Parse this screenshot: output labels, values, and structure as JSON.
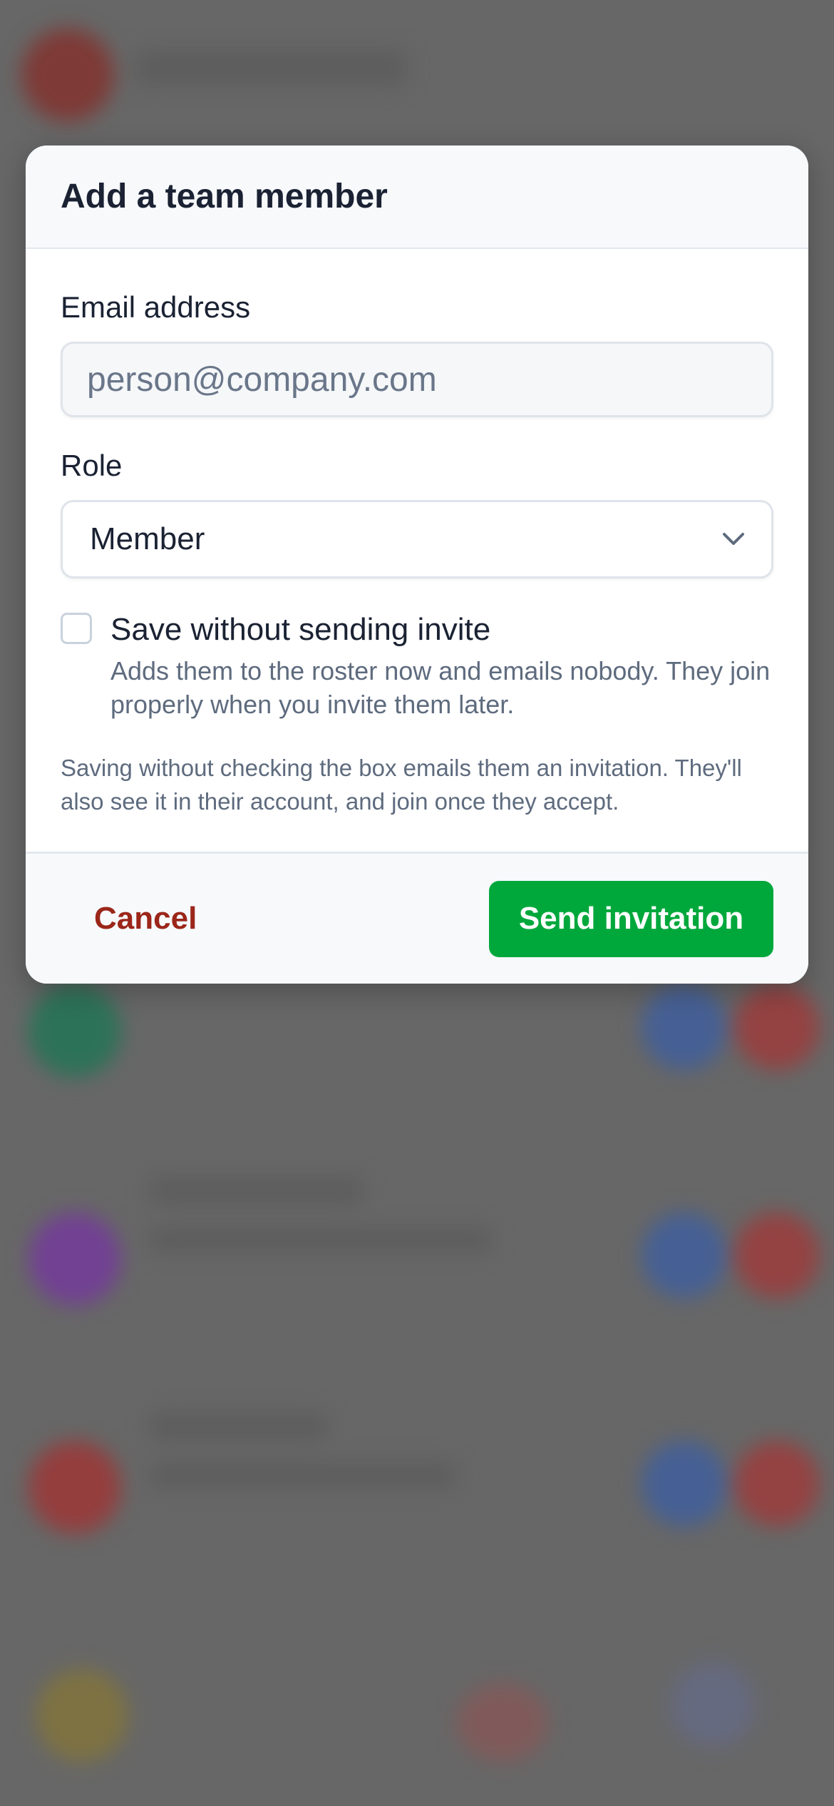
{
  "modal": {
    "title": "Add a team member",
    "email": {
      "label": "Email address",
      "placeholder": "person@company.com",
      "value": ""
    },
    "role": {
      "label": "Role",
      "selected": "Member"
    },
    "save_without_invite": {
      "checked": false,
      "title": "Save without sending invite",
      "description": "Adds them to the roster now and emails nobody. They join properly when you invite them later."
    },
    "note": "Saving without checking the box emails them an invitation. They'll also see it in their account, and join once they accept.",
    "footer": {
      "cancel_label": "Cancel",
      "send_label": "Send invitation"
    },
    "icons": {
      "role_dropdown": "chevron-down-icon",
      "checkbox": "checkbox-unchecked-icon"
    }
  },
  "colors": {
    "primary_button": "#00a83c",
    "cancel_text": "#9b2619",
    "overlay": "#6b6b6b"
  }
}
